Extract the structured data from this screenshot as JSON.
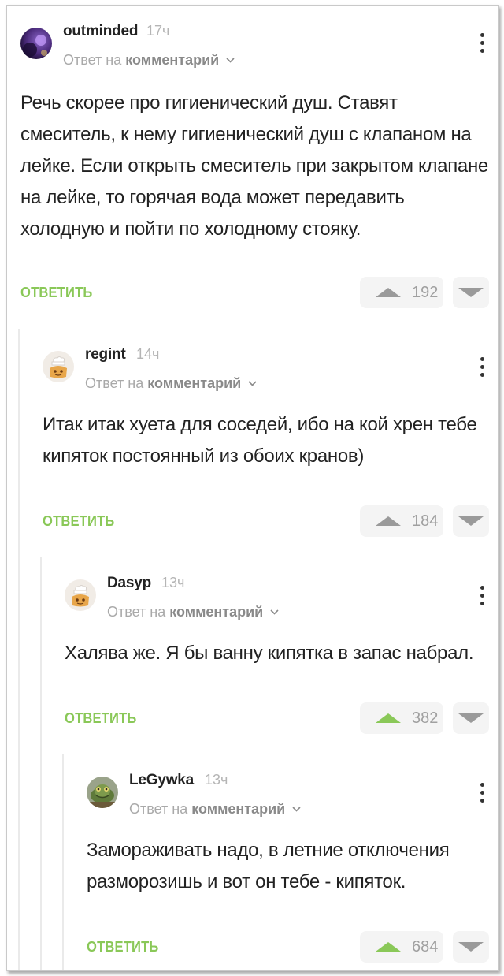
{
  "labels": {
    "reply_to_prefix": "Ответ на",
    "reply_to_target": "комментарий",
    "reply_button": "ОТВЕТИТЬ"
  },
  "comments": [
    {
      "username": "outminded",
      "time": "17ч",
      "text": "Речь скорее про гигиенический душ. Ставят смеситель, к нему гигиенический душ с клапаном на лейке. Если открыть смеситель при закрытом клапане на лейке, то горячая вода может передавить холодную и пойти по холодному стояку.",
      "rating": "192",
      "upvoted": false
    },
    {
      "username": "regint",
      "time": "14ч",
      "text": "Итак итак хуета для соседей, ибо на кой хрен тебе кипяток постоянный из обоих кранов)",
      "rating": "184",
      "upvoted": false
    },
    {
      "username": "Dasyp",
      "time": "13ч",
      "text": "Халява же. Я бы ванну кипятка в запас набрал.",
      "rating": "382",
      "upvoted": true
    },
    {
      "username": "LeGywka",
      "time": "13ч",
      "text": "Замораживать надо, в летние отключения разморозишь и вот он тебе - кипяток.",
      "rating": "684",
      "upvoted": true
    }
  ],
  "colors": {
    "accent_green": "#8ac858",
    "muted_gray": "#a9a9a9"
  },
  "icons": [
    "more-vertical-icon",
    "chevron-down-icon",
    "upvote-icon",
    "downvote-icon"
  ]
}
